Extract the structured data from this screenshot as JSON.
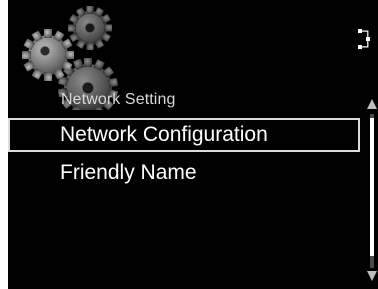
{
  "header": {
    "section_title": "Network Setting",
    "icon": "network-icon"
  },
  "menu": {
    "items": [
      {
        "label": "Network Configuration",
        "selected": true
      },
      {
        "label": "Friendly Name",
        "selected": false
      }
    ]
  },
  "colors": {
    "background": "#000000",
    "text": "#ffffff",
    "section_title": "#d8d8d8",
    "selection_border": "#dcdcdc",
    "gear": "#8c8c8c"
  }
}
